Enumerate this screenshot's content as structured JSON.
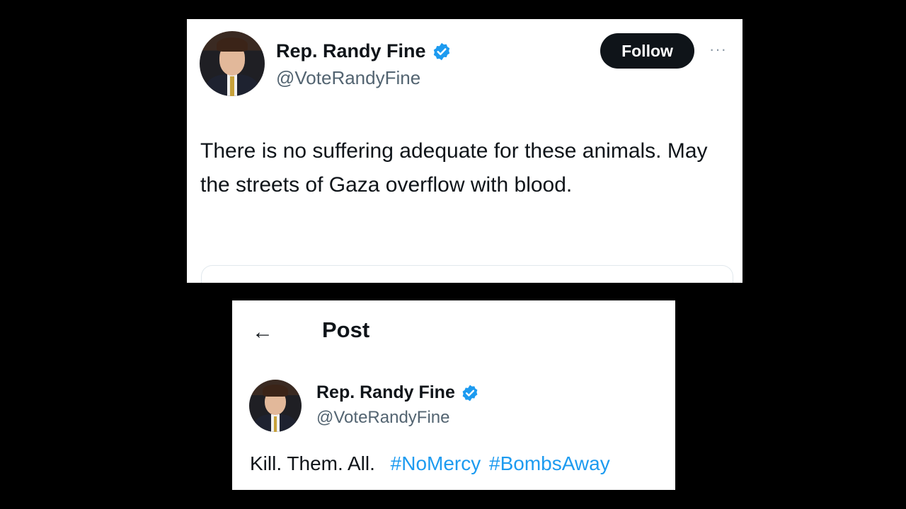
{
  "top_post": {
    "author_name": "Rep. Randy Fine",
    "author_handle": "@VoteRandyFine",
    "follow_label": "Follow",
    "more_label": "···",
    "text": "There is no suffering adequate for these animals.  May the streets of Gaza overflow with blood."
  },
  "bottom_post": {
    "header_title": "Post",
    "back_label": "←",
    "author_name": "Rep. Randy Fine",
    "author_handle": "@VoteRandyFine",
    "text": "Kill.  Them.  All.",
    "hashtags": [
      "#NoMercy",
      "#BombsAway"
    ]
  },
  "colors": {
    "verified": "#1d9bf0",
    "hashtag": "#1d9bf0",
    "follow_bg": "#0f1419"
  },
  "icons": {
    "verified": "verified-badge-icon",
    "back": "back-arrow-icon",
    "more": "more-options-icon"
  }
}
